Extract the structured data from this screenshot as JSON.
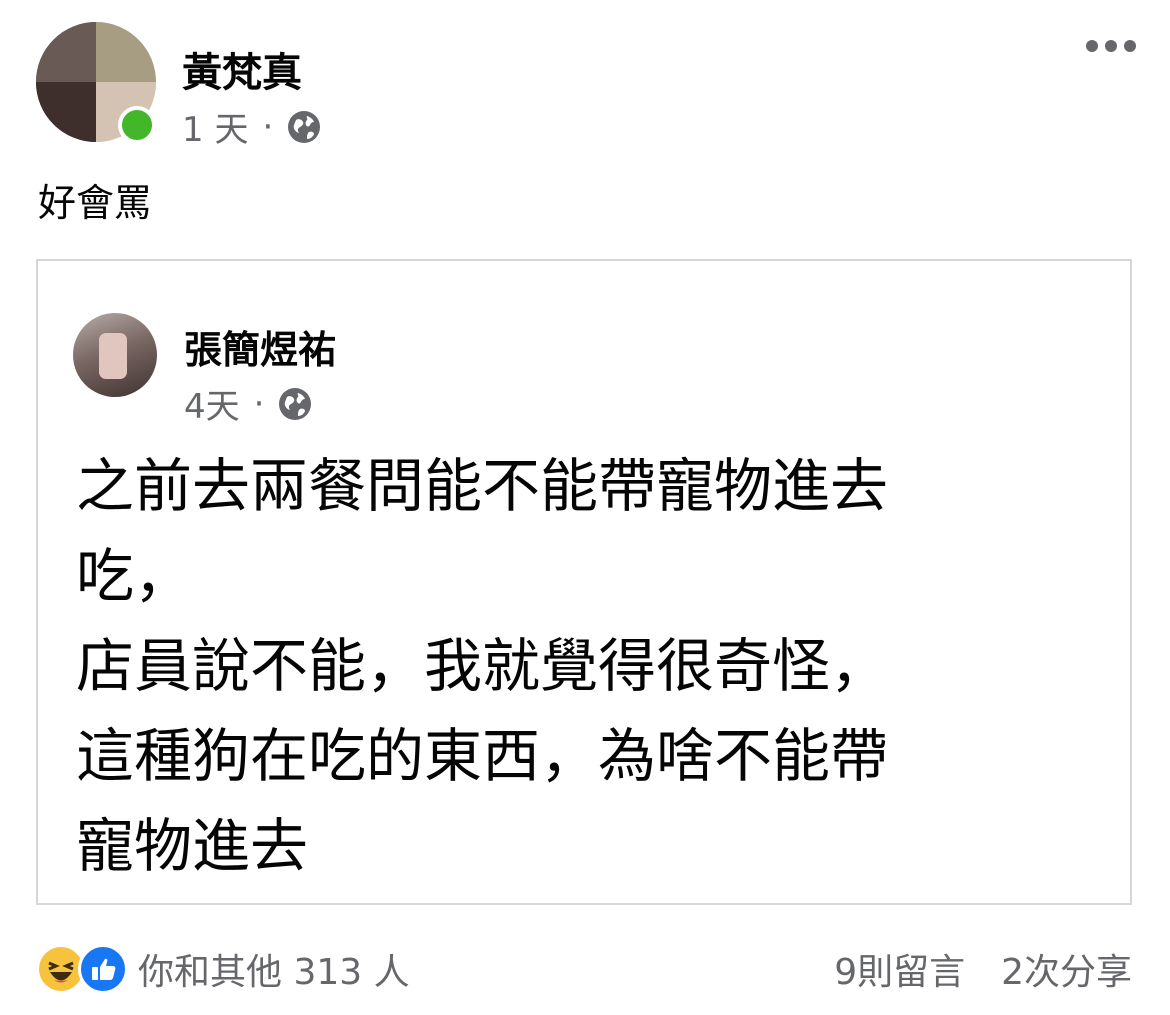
{
  "post": {
    "author": "黃梵真",
    "time": "1 天",
    "separator": "·",
    "text": "好會罵"
  },
  "shared": {
    "author": "張簡煜祐",
    "time": "4天",
    "separator": "·",
    "line1": "之前去兩餐問能不能帶寵物進去",
    "line2": "吃，",
    "line3": "店員說不能，我就覺得很奇怪，",
    "line4": "這種狗在吃的東西，為啥不能帶",
    "line5": "寵物進去"
  },
  "footer": {
    "reactions_text": "你和其他 313 人",
    "comments": "9則留言",
    "shares": "2次分享"
  },
  "icons": [
    "globe-icon",
    "more-options-icon",
    "haha-reaction-icon",
    "like-reaction-icon"
  ]
}
